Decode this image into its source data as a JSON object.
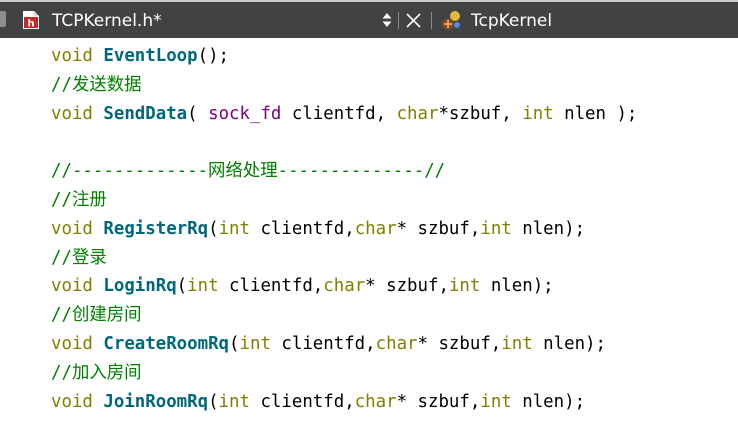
{
  "tab": {
    "file_name": "TCPKernel.h*",
    "symbol": "TcpKernel"
  },
  "code": {
    "l1": {
      "kw": "void",
      "fn": "EventLoop",
      "rest": "();"
    },
    "l2": {
      "comment": "//发送数据"
    },
    "l3": {
      "kw": "void",
      "fn": "SendData",
      "p1": "( ",
      "type": "sock_fd",
      "p2": " clientfd, ",
      "kw2": "char",
      "p3": "*szbuf, ",
      "kw3": "int",
      "p4": " nlen );"
    },
    "l5": {
      "comment": "//-------------网络处理--------------//"
    },
    "l6": {
      "comment": "//注册"
    },
    "l7": {
      "kw": "void",
      "fn": "RegisterRq",
      "p1": "(",
      "kw1": "int",
      "p2": " clientfd,",
      "kw2": "char",
      "p3": "* szbuf,",
      "kw3": "int",
      "p4": " nlen);"
    },
    "l8": {
      "comment": "//登录"
    },
    "l9": {
      "kw": "void",
      "fn": "LoginRq",
      "p1": "(",
      "kw1": "int",
      "p2": " clientfd,",
      "kw2": "char",
      "p3": "* szbuf,",
      "kw3": "int",
      "p4": " nlen);"
    },
    "l10": {
      "comment": "//创建房间"
    },
    "l11": {
      "kw": "void",
      "fn": "CreateRoomRq",
      "p1": "(",
      "kw1": "int",
      "p2": " clientfd,",
      "kw2": "char",
      "p3": "* szbuf,",
      "kw3": "int",
      "p4": " nlen);"
    },
    "l12": {
      "comment": "//加入房间"
    },
    "l13": {
      "kw": "void",
      "fn": "JoinRoomRq",
      "p1": "(",
      "kw1": "int",
      "p2": " clientfd,",
      "kw2": "char",
      "p3": "* szbuf,",
      "kw3": "int",
      "p4": " nlen);"
    }
  },
  "colors": {
    "tabbar_bg": "#404244",
    "keyword": "#808000",
    "function": "#00677c",
    "comment": "#008000",
    "type": "#800080",
    "file_icon": "#c62828"
  },
  "icons": {
    "file": "header-file-icon",
    "sort": "sort-arrows-icon",
    "close": "close-icon",
    "class": "class-icon"
  }
}
